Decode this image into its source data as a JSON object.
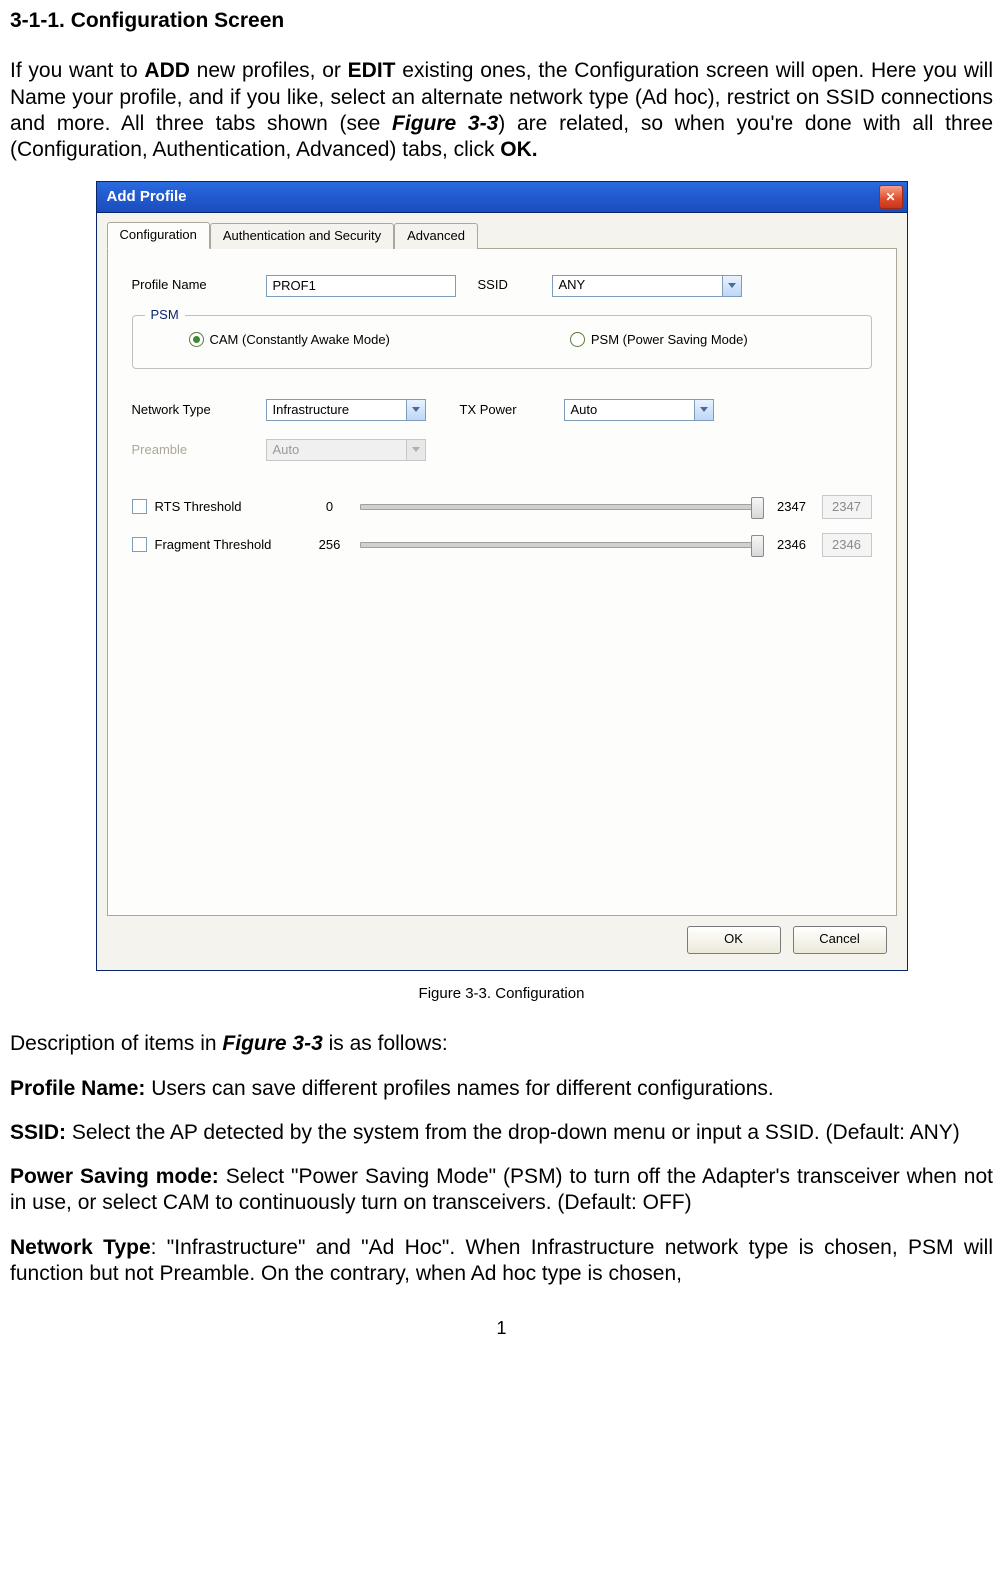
{
  "heading": "3-1-1. Configuration Screen",
  "intro": {
    "pre1": "If you want to ",
    "b1": "ADD",
    "mid1": " new profiles, or ",
    "b2": "EDIT",
    "mid2": " existing ones, the Configuration screen will open. Here you will Name your profile, and if you like, select an alternate network type (Ad hoc), restrict on SSID connections and more. All three tabs shown (see ",
    "b3": "Figure 3-3",
    "mid3": ") are related, so when you're done with all three (Configuration, Authentication, Advanced) tabs, click ",
    "b4": "OK."
  },
  "dialog": {
    "title": "Add Profile",
    "tabs": [
      "Configuration",
      "Authentication and Security",
      "Advanced"
    ],
    "profile_name_label": "Profile Name",
    "profile_name_value": "PROF1",
    "ssid_label": "SSID",
    "ssid_value": "ANY",
    "psm": {
      "legend": "PSM",
      "cam_label": "CAM (Constantly Awake Mode)",
      "psm_label": "PSM (Power Saving Mode)"
    },
    "network_type_label": "Network Type",
    "network_type_value": "Infrastructure",
    "tx_power_label": "TX Power",
    "tx_power_value": "Auto",
    "preamble_label": "Preamble",
    "preamble_value": "Auto",
    "rts": {
      "label": "RTS Threshold",
      "min": "0",
      "max": "2347",
      "value": "2347"
    },
    "frag": {
      "label": "Fragment Threshold",
      "min": "256",
      "max": "2346",
      "value": "2346"
    },
    "ok": "OK",
    "cancel": "Cancel"
  },
  "caption": "Figure 3-3.    Configuration",
  "desc_line": {
    "pre": "Description of items in ",
    "fig": "Figure 3-3",
    "post": " is as follows:"
  },
  "desc": {
    "profile_name_h": "Profile Name:",
    "profile_name_t": " Users can save different profiles names for different configurations.",
    "ssid_h": "SSID:",
    "ssid_t": " Select the AP detected by the system from the drop-down menu or input a SSID. (Default: ANY)",
    "psm_h": "Power Saving mode:",
    "psm_t": " Select \"Power Saving Mode\" (PSM) to turn off the Adapter's transceiver when not in use, or select CAM to continuously turn on transceivers. (Default: OFF)",
    "nt_h": "Network Type",
    "nt_t": ": \"Infrastructure\" and \"Ad Hoc\". When Infrastructure network type is chosen, PSM will function but not Preamble. On the contrary, when Ad hoc type is chosen,"
  },
  "page_number": "1"
}
